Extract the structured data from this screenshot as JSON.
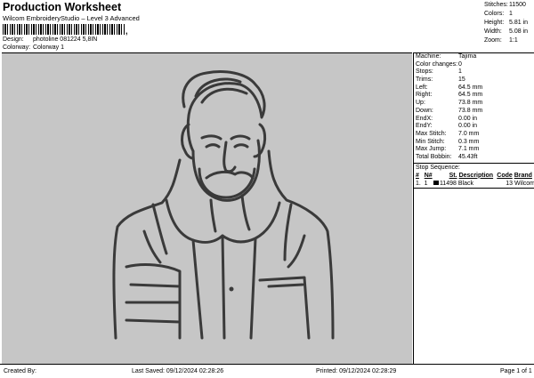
{
  "header": {
    "title": "Production Worksheet",
    "subtitle": "Wilcom EmbroideryStudio – Level 3 Advanced",
    "barcode_suffix": ",",
    "design_label": "Design:",
    "design_value": "photoline 081224 5,8IN",
    "colorway_label": "Colorway:",
    "colorway_value": "Colorway 1"
  },
  "stats": [
    {
      "label": "Stitches:",
      "value": "11500"
    },
    {
      "label": "Colors:",
      "value": "1"
    },
    {
      "label": "Height:",
      "value": "5.81 in"
    },
    {
      "label": "Width:",
      "value": "5.08 in"
    },
    {
      "label": "Zoom:",
      "value": "1:1"
    }
  ],
  "machine": [
    {
      "label": "Machine:",
      "value": "Tajima"
    },
    {
      "label": "Color changes:",
      "value": "0"
    },
    {
      "label": "Stops:",
      "value": "1"
    },
    {
      "label": "Trims:",
      "value": "15"
    },
    {
      "label": "Left:",
      "value": "64.5 mm"
    },
    {
      "label": "Right:",
      "value": "64.5 mm"
    },
    {
      "label": "Up:",
      "value": "73.8 mm"
    },
    {
      "label": "Down:",
      "value": "73.8 mm"
    },
    {
      "label": "EndX:",
      "value": "0.00 in"
    },
    {
      "label": "EndY:",
      "value": "0.00 in"
    },
    {
      "label": "Max Stitch:",
      "value": "7.0 mm"
    },
    {
      "label": "Min Stitch:",
      "value": "0.3 mm"
    },
    {
      "label": "Max Jump:",
      "value": "7.1 mm"
    },
    {
      "label": "Total Bobbin:",
      "value": "45.43ft"
    }
  ],
  "stop_sequence": {
    "title": "Stop Sequence:",
    "headers": {
      "num": "#",
      "n": "N#",
      "st": "St.",
      "desc": "Description",
      "code": "Code",
      "brand": "Brand"
    },
    "rows": [
      {
        "num": "1.",
        "n": "1",
        "st": "11498",
        "desc": "Black",
        "code": "13",
        "brand": "Wilcom",
        "color": "#000000"
      }
    ]
  },
  "footer": {
    "created": "Created By:",
    "saved": "Last Saved: 09/12/2024 02:28:26",
    "printed": "Printed: 09/12/2024 02:28:29",
    "page": "Page 1 of 1"
  },
  "colors": {
    "canvas": "#c6c6c6",
    "stitch": "#3a3a3a"
  }
}
